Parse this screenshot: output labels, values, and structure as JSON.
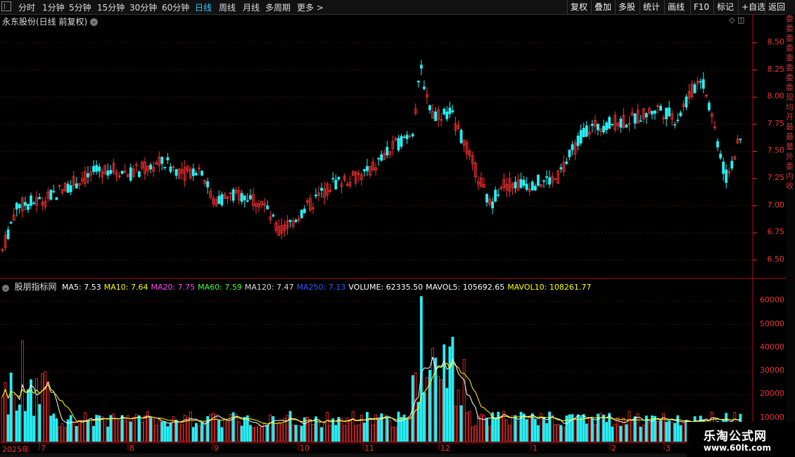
{
  "toolbar": {
    "timeframes": [
      {
        "label": "分时",
        "active": false
      },
      {
        "label": "1分钟",
        "active": false
      },
      {
        "label": "5分钟",
        "active": false
      },
      {
        "label": "15分钟",
        "active": false
      },
      {
        "label": "30分钟",
        "active": false
      },
      {
        "label": "60分钟",
        "active": false
      },
      {
        "label": "日线",
        "active": true
      },
      {
        "label": "周线",
        "active": false
      },
      {
        "label": "月线",
        "active": false
      },
      {
        "label": "多周期",
        "active": false
      },
      {
        "label": "更多 >",
        "active": false
      }
    ],
    "right_buttons": [
      "复权",
      "叠加",
      "多股",
      "统计",
      "画线",
      "F10",
      "标记",
      "+自选",
      "返回"
    ]
  },
  "title": "永东股份(日线 前复权)",
  "indicator": {
    "name": "股朋指标网",
    "items": [
      {
        "text": "MA5: 7.53",
        "color": "#ffffff"
      },
      {
        "text": "MA10: 7.64",
        "color": "#ffff00"
      },
      {
        "text": "MA20: 7.75",
        "color": "#ff40ff"
      },
      {
        "text": "MA60: 7.59",
        "color": "#40ff40"
      },
      {
        "text": "MA120: 7.47",
        "color": "#dddddd"
      },
      {
        "text": "MA250: 7.13",
        "color": "#2f5bff"
      },
      {
        "text": "VOLUME: 62335.50",
        "color": "#ffffff"
      },
      {
        "text": "MAVOL5: 105692.65",
        "color": "#ffffff"
      },
      {
        "text": "MAVOL10: 108261.77",
        "color": "#ffff00"
      }
    ]
  },
  "price_axis": [
    "8.50",
    "8.25",
    "8.00",
    "7.75",
    "7.50",
    "7.25",
    "7.00",
    "6.75",
    "6.50"
  ],
  "volume_axis": [
    "60000",
    "50000",
    "40000",
    "30000",
    "20000",
    "10000"
  ],
  "x_labels": [
    "2025年",
    "7",
    "8",
    "9",
    "10",
    "11",
    "12",
    "1",
    "2",
    "3"
  ],
  "side_text": "委委委委委委委委现均开最最量外委内收",
  "watermark": {
    "line1": "乐淘公式网",
    "line2": "www.60lt.com"
  },
  "colors": {
    "up": "#ff3232",
    "down": "#25f0f5",
    "grid": "#3a0f0f",
    "axis": "#e33"
  },
  "chart_data": {
    "type": "candlestick",
    "price_range": [
      6.37,
      8.7
    ],
    "volume_range": [
      0,
      64000
    ],
    "y_ticks": [
      6.5,
      6.75,
      7.0,
      7.25,
      7.5,
      7.75,
      8.0,
      8.25,
      8.5
    ],
    "volume_ticks": [
      10000,
      20000,
      30000,
      40000,
      50000,
      60000
    ],
    "key_points": [
      {
        "month": "6",
        "close": 6.5
      },
      {
        "month": "7",
        "close": 7.05
      },
      {
        "month": "8",
        "close": 7.4
      },
      {
        "month": "9",
        "close": 7.05
      },
      {
        "month": "10",
        "close": 6.8
      },
      {
        "month": "11",
        "close": 7.5
      },
      {
        "month": "11-peak",
        "close": 8.25,
        "volume": 62000
      },
      {
        "month": "12",
        "close": 7.8
      },
      {
        "month": "1",
        "close": 7.1
      },
      {
        "month": "2",
        "close": 7.8
      },
      {
        "month": "3",
        "close": 8.2
      },
      {
        "month": "last",
        "close": 7.6,
        "volume": 10000
      }
    ]
  }
}
